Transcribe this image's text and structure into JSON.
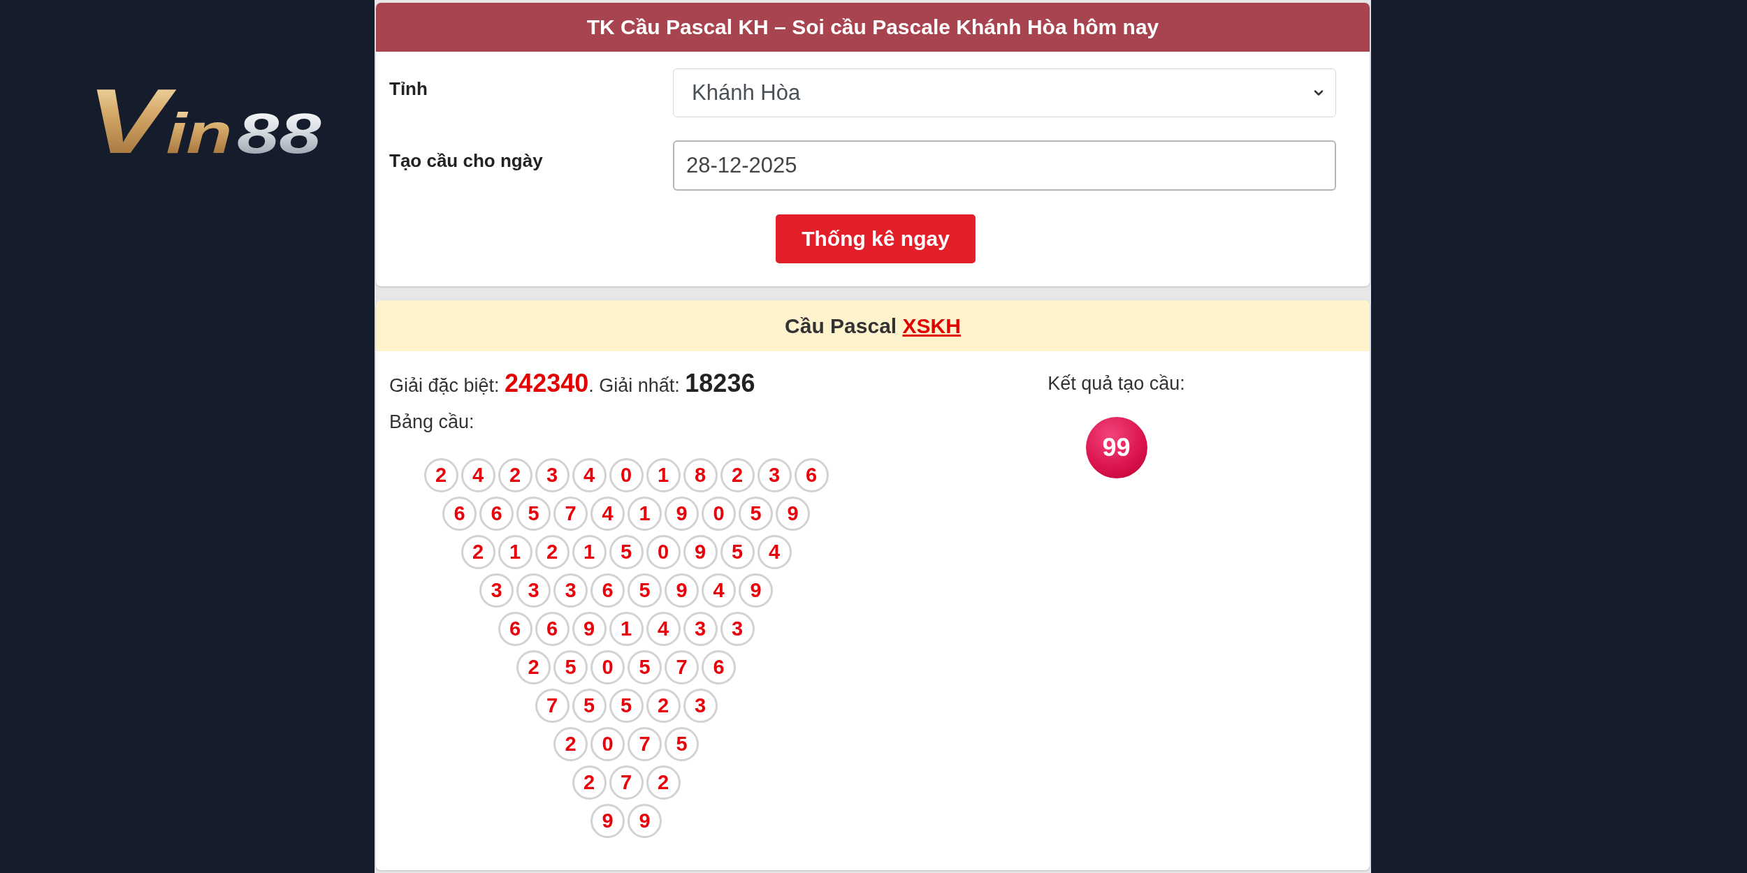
{
  "logo": {
    "initial": "V",
    "part_1": "in",
    "part_2": "88"
  },
  "form_card": {
    "title": "TK Cầu Pascal KH – Soi cầu Pascale Khánh Hòa hôm nay",
    "fields": [
      {
        "kind": "select",
        "label": "Tỉnh",
        "value": "Khánh Hòa"
      },
      {
        "kind": "date",
        "label": "Tạo cầu cho ngày",
        "value": "28-12-2025"
      }
    ],
    "submit_button": "Thống kê ngay"
  },
  "result_card": {
    "title": "Cầu Pascal",
    "title_link": "XSKH",
    "prizes_line": "Giải đặc biệt: **242340**. Giải nhất: **18236**",
    "table_label": "Bảng cầu:",
    "pascal_rows": [
      [
        "2",
        "4",
        "2",
        "3",
        "4",
        "0",
        "1",
        "8",
        "2",
        "3",
        "6"
      ],
      [
        "6",
        "6",
        "5",
        "7",
        "4",
        "1",
        "9",
        "0",
        "5",
        "9"
      ],
      [
        "2",
        "1",
        "2",
        "1",
        "5",
        "0",
        "9",
        "5",
        "4"
      ],
      [
        "3",
        "3",
        "3",
        "6",
        "5",
        "9",
        "4",
        "9"
      ],
      [
        "6",
        "6",
        "9",
        "1",
        "4",
        "3",
        "3"
      ],
      [
        "2",
        "5",
        "0",
        "5",
        "7",
        "6"
      ],
      [
        "7",
        "5",
        "5",
        "2",
        "3"
      ],
      [
        "2",
        "0",
        "7",
        "5"
      ],
      [
        "2",
        "7",
        "2"
      ],
      [
        "9",
        "9"
      ]
    ],
    "result_label": "Kết quả tạo cầu:",
    "result": "99"
  }
}
